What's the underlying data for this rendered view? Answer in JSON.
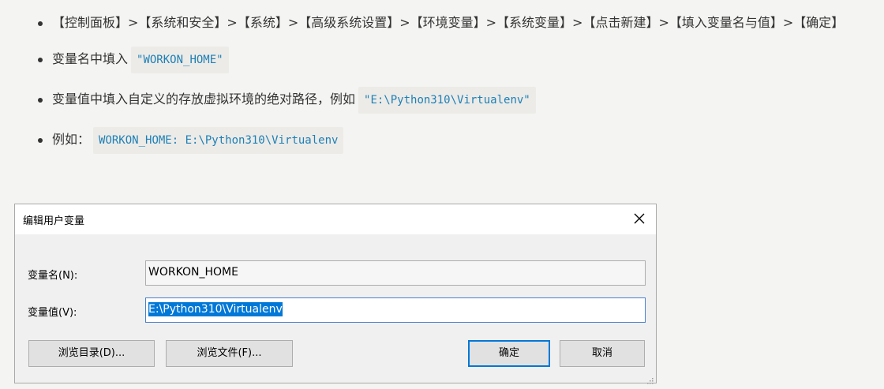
{
  "article": {
    "steps": [
      {
        "text": "【控制面板】>【系统和安全】>【系统】>【高级系统设置】>【环境变量】>【系统变量】>【点击新建】>【填入变量名与值】>【确定】"
      },
      {
        "text": "变量名中填入",
        "code": "\"WORKON_HOME\""
      },
      {
        "text": "变量值中填入自定义的存放虚拟环境的绝对路径，例如",
        "code": "\"E:\\Python310\\Virtualenv\""
      },
      {
        "text": "例如：",
        "code": "WORKON_HOME: E:\\Python310\\Virtualenv"
      }
    ]
  },
  "dialog": {
    "title": "编辑用户变量",
    "name_label": "变量名(N):",
    "name_value": "WORKON_HOME",
    "value_label": "变量值(V):",
    "value_value": "E:\\Python310\\Virtualenv",
    "browse_dir_label": "浏览目录(D)...",
    "browse_file_label": "浏览文件(F)...",
    "ok_label": "确定",
    "cancel_label": "取消",
    "close_icon": "close-icon",
    "accent_color": "#0078d7"
  }
}
